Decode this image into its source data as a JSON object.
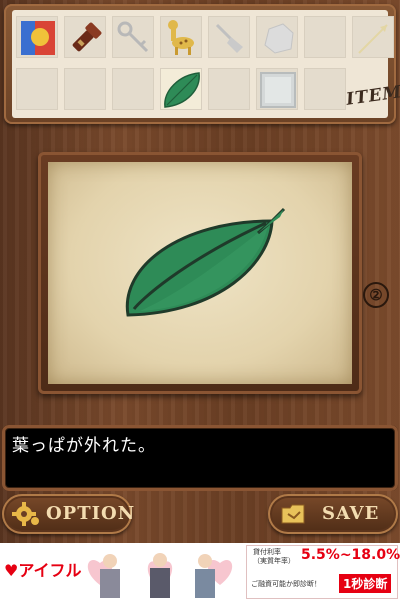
{
  "inventory": {
    "label": "ITEM",
    "slots": [
      {
        "icon": "flag-badge-icon"
      },
      {
        "icon": "flashlight-icon"
      },
      {
        "icon": "key-icon"
      },
      {
        "icon": "toy-giraffe-icon"
      },
      {
        "icon": "shovel-icon"
      },
      {
        "icon": "rock-icon"
      },
      {
        "icon": "empty"
      },
      {
        "icon": "arrow-icon"
      },
      {
        "icon": "empty"
      },
      {
        "icon": "empty"
      },
      {
        "icon": "empty"
      },
      {
        "icon": "leaf-icon"
      },
      {
        "icon": "empty"
      },
      {
        "icon": "glass-panel-icon"
      },
      {
        "icon": "empty"
      }
    ],
    "selected_index": 11
  },
  "viewer": {
    "item_icon": "leaf-icon",
    "page_number": "②"
  },
  "message": {
    "text": "葉っぱが外れた。"
  },
  "buttons": {
    "option_label": "OPTION",
    "save_label": "SAVE"
  },
  "ad": {
    "brand": "アイフル",
    "rate_label": "貸付利率（実質年率）",
    "rate": "5.5%~18.0%",
    "diagnosis_label": "ご融資可能か即診断！",
    "diagnosis": "1秒診断"
  },
  "colors": {
    "leaf_fill": "#2e8b57",
    "leaf_dark": "#1f5e3a",
    "wood": "#6b3f24",
    "ad_red": "#e60012"
  }
}
